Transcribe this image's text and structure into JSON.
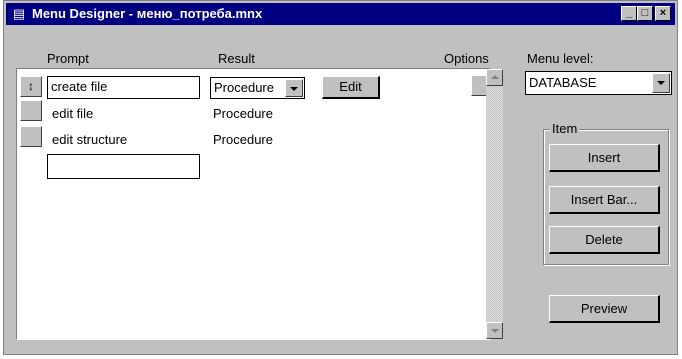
{
  "window": {
    "title": "Menu Designer - меню_потреба.mnx"
  },
  "headers": {
    "prompt": "Prompt",
    "result": "Result",
    "options": "Options",
    "menu_level": "Menu level:"
  },
  "rows": [
    {
      "prompt": "create file",
      "result": "Procedure",
      "action": "Edit",
      "mover": "↕"
    },
    {
      "prompt": "edit file",
      "result": "Procedure"
    },
    {
      "prompt": "edit structure",
      "result": "Procedure"
    },
    {
      "prompt": "",
      "result": ""
    }
  ],
  "menu_level": {
    "value": "DATABASE"
  },
  "item_group": {
    "label": "Item",
    "insert": "Insert",
    "insert_bar": "Insert Bar...",
    "delete": "Delete"
  },
  "preview": {
    "label": "Preview"
  },
  "icons": {
    "app": "menu-designer-icon"
  }
}
